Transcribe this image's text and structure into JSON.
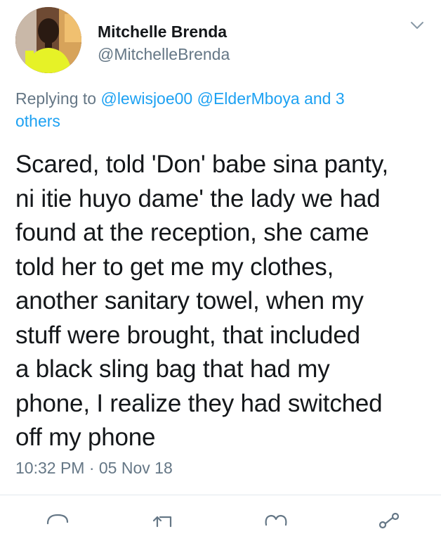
{
  "author": {
    "name": "Mitchelle Brenda",
    "handle": "@MitchelleBrenda"
  },
  "reply": {
    "prefix": "Replying to",
    "mention_1": "@lewisjoe00",
    "mention_2": "@ElderMboya",
    "others_line_1": "and 3",
    "others_line_2": "others"
  },
  "tweet": {
    "lines": [
      "Scared, told 'Don' babe sina panty,",
      "ni itie huyo dame' the lady we had",
      "found at the reception, she came",
      "told her to get me my clothes,",
      "another sanitary towel, when my",
      "stuff were brought, that included",
      "a black sling bag that had my",
      "phone, I realize they had switched",
      "off my phone"
    ],
    "timestamp": "10:32 PM · 05 Nov 18"
  },
  "icons": {
    "menu": "chevron-down-icon",
    "reply": "reply-icon",
    "retweet": "retweet-icon",
    "like": "heart-icon",
    "share": "share-icon"
  },
  "colors": {
    "link": "#1da1f2",
    "secondary_text": "#657786",
    "primary_text": "#14171a",
    "avatar_shirt": "#e6f227"
  }
}
